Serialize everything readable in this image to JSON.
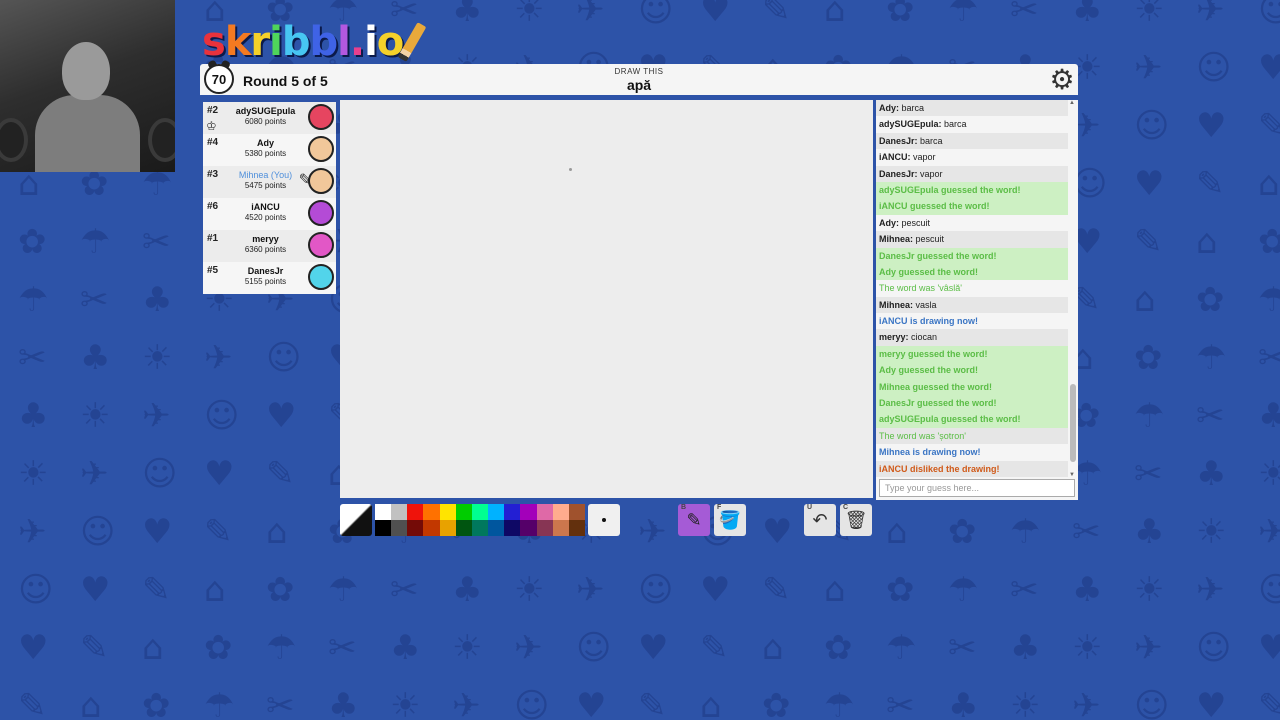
{
  "logo": {
    "text": "skribbl.io"
  },
  "header": {
    "timer": "70",
    "round": "Round 5 of 5",
    "word_label": "DRAW THIS",
    "word": "apă"
  },
  "players": [
    {
      "rank": "#2",
      "name": "adySUGEpula",
      "points": "6080 points",
      "avatar_color": "#e64560",
      "owner": true,
      "you": false,
      "drawing": false
    },
    {
      "rank": "#4",
      "name": "Ady",
      "points": "5380 points",
      "avatar_color": "#f1c79a",
      "owner": false,
      "you": false,
      "drawing": false
    },
    {
      "rank": "#3",
      "name": "Mihnea (You)",
      "points": "5475 points",
      "avatar_color": "#f1c79a",
      "owner": false,
      "you": true,
      "drawing": true
    },
    {
      "rank": "#6",
      "name": "iANCU",
      "points": "4520 points",
      "avatar_color": "#b44bd6",
      "owner": false,
      "you": false,
      "drawing": false
    },
    {
      "rank": "#1",
      "name": "meryy",
      "points": "6360 points",
      "avatar_color": "#e257c6",
      "owner": false,
      "you": false,
      "drawing": false
    },
    {
      "rank": "#5",
      "name": "DanesJr",
      "points": "5155 points",
      "avatar_color": "#52d4ea",
      "owner": false,
      "you": false,
      "drawing": false
    }
  ],
  "chat": {
    "messages": [
      {
        "who": "Ady:",
        "text": " barca",
        "type": "normal"
      },
      {
        "who": "adySUGEpula:",
        "text": " barca",
        "type": "normal"
      },
      {
        "who": "DanesJr:",
        "text": " barca",
        "type": "normal"
      },
      {
        "who": "iANCU:",
        "text": " vapor",
        "type": "normal"
      },
      {
        "who": "DanesJr:",
        "text": " vapor",
        "type": "normal"
      },
      {
        "who": "",
        "text": "adySUGEpula guessed the word!",
        "type": "guess"
      },
      {
        "who": "",
        "text": "iANCU guessed the word!",
        "type": "guess"
      },
      {
        "who": "Ady:",
        "text": " pescuit",
        "type": "normal"
      },
      {
        "who": "Mihnea:",
        "text": " pescuit",
        "type": "normal"
      },
      {
        "who": "",
        "text": "DanesJr guessed the word!",
        "type": "guess"
      },
      {
        "who": "",
        "text": "Ady guessed the word!",
        "type": "guess"
      },
      {
        "who": "",
        "text": "The word was 'vâslă'",
        "type": "reveal"
      },
      {
        "who": "Mihnea:",
        "text": " vasla",
        "type": "normal"
      },
      {
        "who": "",
        "text": "iANCU is drawing now!",
        "type": "drawing"
      },
      {
        "who": "meryy:",
        "text": " ciocan",
        "type": "normal"
      },
      {
        "who": "",
        "text": "meryy guessed the word!",
        "type": "guess"
      },
      {
        "who": "",
        "text": "Ady guessed the word!",
        "type": "guess"
      },
      {
        "who": "",
        "text": "Mihnea guessed the word!",
        "type": "guess"
      },
      {
        "who": "",
        "text": "DanesJr guessed the word!",
        "type": "guess"
      },
      {
        "who": "",
        "text": "adySUGEpula guessed the word!",
        "type": "guess"
      },
      {
        "who": "",
        "text": "The word was 'șotron'",
        "type": "reveal"
      },
      {
        "who": "",
        "text": "Mihnea is drawing now!",
        "type": "drawing"
      },
      {
        "who": "",
        "text": "iANCU disliked the drawing!",
        "type": "dislike"
      }
    ],
    "input_placeholder": "Type your guess here..."
  },
  "toolbar": {
    "palette": [
      "#ffffff",
      "#c1c1c1",
      "#ef130b",
      "#ff7100",
      "#ffe400",
      "#00cc00",
      "#00ff91",
      "#00b2ff",
      "#231fd3",
      "#a300ba",
      "#df69a7",
      "#ffac8e",
      "#a0522d",
      "#000000",
      "#505050",
      "#740b07",
      "#c23800",
      "#e8a200",
      "#005510",
      "#00785d",
      "#00569e",
      "#0e0865",
      "#550069",
      "#873554",
      "#cc774d",
      "#63300d"
    ],
    "tools": {
      "brush_key": "B",
      "fill_key": "F",
      "undo_key": "U",
      "clear_key": "C"
    }
  },
  "colors": {
    "background": "#2d53a8",
    "guess_text": "#5bbd46",
    "drawing_text": "#3a75c4",
    "dislike_text": "#d05a19",
    "you_text": "#4f8fdb"
  }
}
